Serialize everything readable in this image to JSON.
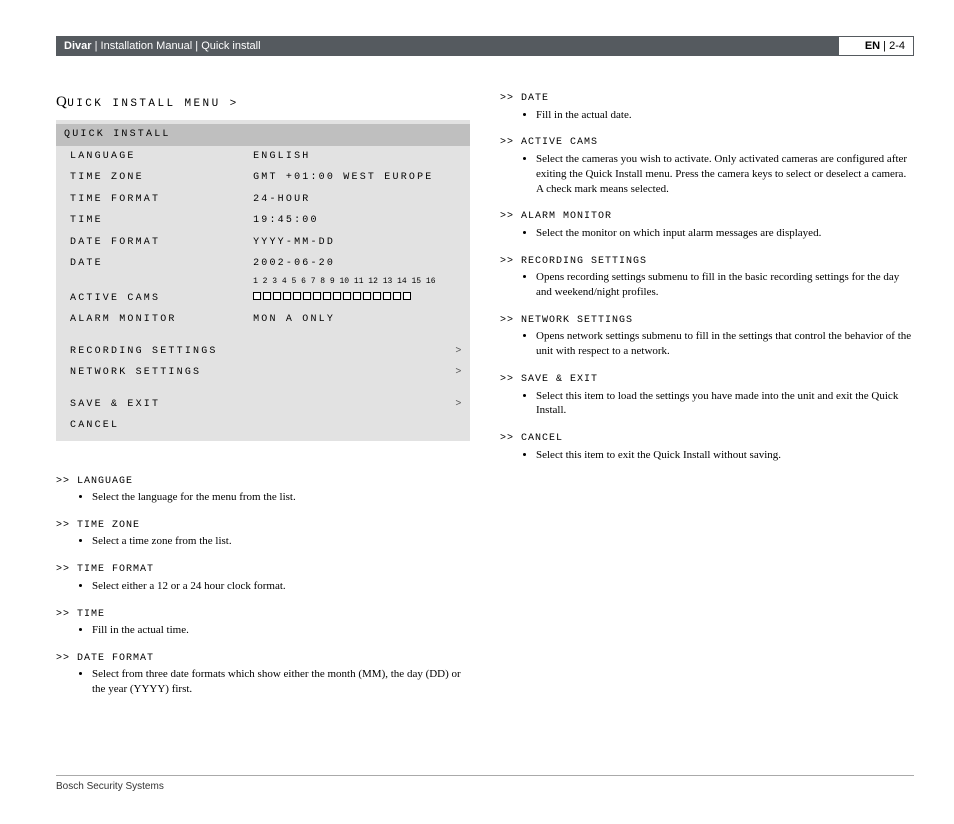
{
  "header": {
    "product": "Divar",
    "breadcrumb_1": "Installation Manual",
    "breadcrumb_2": "Quick install",
    "lang": "EN",
    "page": "2-4",
    "sep": " | "
  },
  "section_title": "QUICK INSTALL MENU >",
  "quick_install": {
    "title": "QUICK INSTALL",
    "rows": [
      {
        "label": "LANGUAGE",
        "value": "ENGLISH"
      },
      {
        "label": "TIME ZONE",
        "value": "GMT +01:00 WEST EUROPE"
      },
      {
        "label": "TIME FORMAT",
        "value": "24-HOUR"
      },
      {
        "label": "TIME",
        "value": "19:45:00"
      },
      {
        "label": "DATE FORMAT",
        "value": "YYYY-MM-DD"
      },
      {
        "label": "DATE",
        "value": "2002-06-20"
      }
    ],
    "cam_numbers": "1  2  3  4  5  6  7  8  9 10 11 12 13 14 15 16",
    "active_cams_label": "ACTIVE CAMS",
    "alarm_monitor": {
      "label": "ALARM MONITOR",
      "value": "MON A ONLY"
    },
    "recording": "RECORDING SETTINGS",
    "network": "NETWORK SETTINGS",
    "save": "SAVE & EXIT",
    "cancel": "CANCEL",
    "chev": ">"
  },
  "items_left": [
    {
      "heading": ">> LANGUAGE",
      "body": "Select the language for the menu from the list."
    },
    {
      "heading": ">> TIME ZONE",
      "body": "Select a time zone from the list."
    },
    {
      "heading": ">> TIME FORMAT",
      "body": "Select either a 12 or a 24 hour clock format."
    },
    {
      "heading": ">> TIME",
      "body": "Fill in the actual time."
    },
    {
      "heading": ">> DATE FORMAT",
      "body": "Select from three date formats which show either the month (MM), the day (DD) or the year (YYYY) first."
    }
  ],
  "items_right": [
    {
      "heading": ">> DATE",
      "body": "Fill in the actual date."
    },
    {
      "heading": ">> ACTIVE CAMS",
      "body": "Select the cameras you wish to activate. Only activated cameras are configured after exiting the Quick Install menu. Press the camera keys to select or deselect a camera. A check mark means selected."
    },
    {
      "heading": ">> ALARM MONITOR",
      "body": "Select the monitor on which input alarm messages are displayed."
    },
    {
      "heading": ">> RECORDING SETTINGS",
      "body": "Opens recording settings submenu to fill in the basic recording settings for the day and weekend/night profiles."
    },
    {
      "heading": ">> NETWORK SETTINGS",
      "body": "Opens network settings submenu to fill in the settings that control the behavior of the unit with respect to a network."
    },
    {
      "heading": ">> SAVE & EXIT",
      "body": "Select this item to load the settings you have made into the unit and exit the Quick Install."
    },
    {
      "heading": ">> CANCEL",
      "body": "Select this item to exit the Quick Install without saving."
    }
  ],
  "footer": "Bosch Security Systems"
}
